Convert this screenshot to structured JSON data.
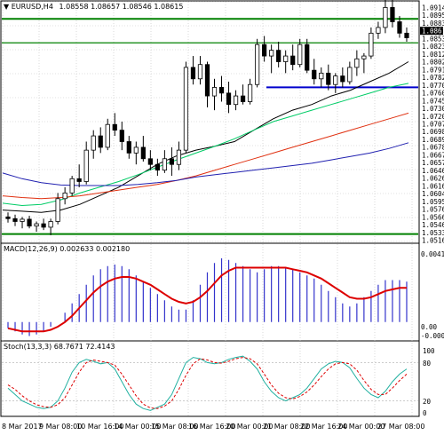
{
  "header": {
    "symbol": "EURUSD,H4",
    "ohlc": "1.08558 1.08657 1.08546 1.08615"
  },
  "price_axis": {
    "labels": [
      "1.09140",
      "1.08950",
      "1.08835",
      "1.08615",
      "1.08530",
      "1.08230",
      "1.08125",
      "1.08025",
      "1.07915",
      "1.07825",
      "1.07700",
      "1.07605",
      "1.07450",
      "1.07300",
      "1.07200",
      "1.07075",
      "1.06985",
      "1.06895",
      "1.06785",
      "1.06670",
      "1.06575",
      "1.06460",
      "1.06265",
      "1.06165",
      "1.06040",
      "1.05955",
      "1.05760",
      "1.05660",
      "1.05465",
      "1.05330",
      "1.05160"
    ],
    "current_price": "1.08615"
  },
  "macd": {
    "label": "MACD(12,26,9) 0.002633 0.002180",
    "axis_labels": [
      "0.004116",
      "0.00",
      "-0.000901"
    ]
  },
  "stoch": {
    "label": "Stoch(13,3,3) 68.7671 72.4143",
    "axis_labels": [
      "100",
      "80",
      "20",
      "0"
    ]
  },
  "time_axis": [
    "8 Mar 2017",
    "9 Mar 08:00",
    "10 Mar 16:00",
    "14 Mar 00:00",
    "15 Mar 08:00",
    "16 Mar 16:00",
    "20 Mar 00:00",
    "21 Mar 08:00",
    "22 Mar 16:00",
    "24 Mar 00:00",
    "27 Mar 08:00"
  ],
  "colors": {
    "candle": "#000000",
    "support_resistance": "#008000",
    "pivot_line": "#0000cc",
    "ma_fast": "#000000",
    "ma_mid": "#00cc66",
    "ma_slow": "#e03010",
    "ma_long": "#2020b0",
    "macd_hist": "#3333cc",
    "macd_signal": "#dd0000",
    "stoch_main": "#20b0a0",
    "stoch_signal": "#dd0000"
  },
  "chart_data": {
    "type": "candlestick",
    "symbol": "EURUSD",
    "timeframe": "H4",
    "horizontal_levels": [
      1.0895,
      1.0853,
      1.0775,
      1.0518
    ],
    "candles": [
      [
        1.0548,
        1.0556,
        1.0538,
        1.0545
      ],
      [
        1.0545,
        1.0552,
        1.0532,
        1.054
      ],
      [
        1.054,
        1.0548,
        1.0528,
        1.0544
      ],
      [
        1.0544,
        1.055,
        1.0528,
        1.0532
      ],
      [
        1.0532,
        1.054,
        1.0522,
        1.0536
      ],
      [
        1.0536,
        1.0545,
        1.0525,
        1.053
      ],
      [
        1.053,
        1.0545,
        1.0516,
        1.054
      ],
      [
        1.054,
        1.059,
        1.0535,
        1.058
      ],
      [
        1.058,
        1.06,
        1.057,
        1.059
      ],
      [
        1.059,
        1.062,
        1.0585,
        1.0615
      ],
      [
        1.0615,
        1.064,
        1.06,
        1.061
      ],
      [
        1.061,
        1.068,
        1.0605,
        1.0665
      ],
      [
        1.0665,
        1.07,
        1.065,
        1.069
      ],
      [
        1.069,
        1.0705,
        1.066,
        1.067
      ],
      [
        1.067,
        1.072,
        1.0665,
        1.071
      ],
      [
        1.071,
        1.073,
        1.069,
        1.07
      ],
      [
        1.07,
        1.0715,
        1.0665,
        1.068
      ],
      [
        1.068,
        1.069,
        1.065,
        1.066
      ],
      [
        1.066,
        1.068,
        1.064,
        1.067
      ],
      [
        1.067,
        1.069,
        1.0645,
        1.065
      ],
      [
        1.065,
        1.0665,
        1.063,
        1.064
      ],
      [
        1.064,
        1.065,
        1.062,
        1.063
      ],
      [
        1.063,
        1.0665,
        1.0625,
        1.065
      ],
      [
        1.065,
        1.067,
        1.062,
        1.064
      ],
      [
        1.064,
        1.068,
        1.063,
        1.0665
      ],
      [
        1.0665,
        1.082,
        1.066,
        1.081
      ],
      [
        1.081,
        1.083,
        1.078,
        1.079
      ],
      [
        1.079,
        1.083,
        1.078,
        1.0815
      ],
      [
        1.0815,
        1.082,
        1.074,
        1.076
      ],
      [
        1.076,
        1.079,
        1.0735,
        1.0775
      ],
      [
        1.0775,
        1.0795,
        1.075,
        1.0765
      ],
      [
        1.0765,
        1.0785,
        1.073,
        1.0745
      ],
      [
        1.0745,
        1.077,
        1.0735,
        1.076
      ],
      [
        1.076,
        1.078,
        1.0745,
        1.075
      ],
      [
        1.075,
        1.079,
        1.0745,
        1.078
      ],
      [
        1.078,
        1.086,
        1.0775,
        1.085
      ],
      [
        1.085,
        1.0865,
        1.082,
        1.083
      ],
      [
        1.083,
        1.085,
        1.08,
        1.084
      ],
      [
        1.084,
        1.0855,
        1.081,
        1.082
      ],
      [
        1.082,
        1.084,
        1.08,
        1.083
      ],
      [
        1.083,
        1.085,
        1.0805,
        1.0815
      ],
      [
        1.0815,
        1.086,
        1.081,
        1.085
      ],
      [
        1.085,
        1.086,
        1.08,
        1.0805
      ],
      [
        1.0805,
        1.0825,
        1.078,
        1.079
      ],
      [
        1.079,
        1.081,
        1.0775,
        1.08
      ],
      [
        1.08,
        1.0815,
        1.077,
        1.078
      ],
      [
        1.078,
        1.08,
        1.0765,
        1.0795
      ],
      [
        1.0795,
        1.081,
        1.0775,
        1.0785
      ],
      [
        1.0785,
        1.082,
        1.078,
        1.081
      ],
      [
        1.081,
        1.084,
        1.0795,
        1.0825
      ],
      [
        1.0825,
        1.0835,
        1.08,
        1.083
      ],
      [
        1.083,
        1.088,
        1.0825,
        1.087
      ],
      [
        1.087,
        1.089,
        1.086,
        1.088
      ],
      [
        1.088,
        1.093,
        1.087,
        1.0915
      ],
      [
        1.0915,
        1.095,
        1.088,
        1.089
      ],
      [
        1.089,
        1.09,
        1.0862,
        1.087
      ],
      [
        1.087,
        1.088,
        1.0855,
        1.0862
      ]
    ],
    "moving_averages": [
      {
        "color": "#000000",
        "values": [
          1.056,
          1.0558,
          1.0556,
          1.056,
          1.057,
          1.0585,
          1.06,
          1.062,
          1.064,
          1.0655,
          1.0665,
          1.0672,
          1.068,
          1.07,
          1.072,
          1.0735,
          1.0745,
          1.076,
          1.077,
          1.0785,
          1.08,
          1.082
        ]
      },
      {
        "color": "#00cc66",
        "values": [
          1.0572,
          1.0568,
          1.057,
          1.0578,
          1.059,
          1.06,
          1.061,
          1.0622,
          1.0635,
          1.0648,
          1.066,
          1.0672,
          1.0685,
          1.07,
          1.0715,
          1.0725,
          1.0735,
          1.0745,
          1.0755,
          1.0765,
          1.0775,
          1.0782
        ]
      },
      {
        "color": "#e03010",
        "values": [
          1.0585,
          1.0582,
          1.058,
          1.0582,
          1.0585,
          1.059,
          1.0595,
          1.06,
          1.0605,
          1.0612,
          1.062,
          1.063,
          1.064,
          1.065,
          1.066,
          1.067,
          1.068,
          1.069,
          1.07,
          1.071,
          1.072,
          1.073
        ]
      },
      {
        "color": "#2020b0",
        "values": [
          1.0625,
          1.0615,
          1.0608,
          1.0604,
          1.0603,
          1.0603,
          1.0603,
          1.0605,
          1.0608,
          1.0612,
          1.0618,
          1.0622,
          1.0626,
          1.063,
          1.0634,
          1.0638,
          1.0642,
          1.0648,
          1.0654,
          1.066,
          1.0668,
          1.0678
        ]
      }
    ],
    "macd_histogram": [
      -0.0004,
      -0.0006,
      -0.0008,
      -0.0009,
      -0.0008,
      -0.0006,
      -0.0003,
      0.0,
      0.0006,
      0.0012,
      0.0018,
      0.0024,
      0.003,
      0.0034,
      0.0036,
      0.0037,
      0.0036,
      0.0034,
      0.003,
      0.0026,
      0.0022,
      0.0018,
      0.0014,
      0.001,
      0.0008,
      0.0008,
      0.0014,
      0.0024,
      0.0032,
      0.0038,
      0.0041,
      0.004,
      0.0038,
      0.0036,
      0.0034,
      0.0032,
      0.0034,
      0.0036,
      0.0036,
      0.0035,
      0.0034,
      0.0032,
      0.003,
      0.0028,
      0.0024,
      0.002,
      0.0016,
      0.0012,
      0.001,
      0.0012,
      0.0016,
      0.002,
      0.0024,
      0.0027,
      0.0027,
      0.0027,
      0.0026
    ],
    "macd_signal": [
      -0.0004,
      -0.0005,
      -0.0006,
      -0.0006,
      -0.0006,
      -0.0006,
      -0.0005,
      -0.0003,
      0.0,
      0.0004,
      0.0009,
      0.0014,
      0.0019,
      0.0023,
      0.0026,
      0.0028,
      0.0029,
      0.0029,
      0.0028,
      0.0026,
      0.0024,
      0.0021,
      0.0018,
      0.0015,
      0.0013,
      0.0012,
      0.0013,
      0.0016,
      0.002,
      0.0025,
      0.003,
      0.0033,
      0.0035,
      0.0035,
      0.0035,
      0.0035,
      0.0035,
      0.0035,
      0.0035,
      0.0035,
      0.0034,
      0.0033,
      0.0032,
      0.003,
      0.0028,
      0.0025,
      0.0022,
      0.0019,
      0.0016,
      0.0015,
      0.0015,
      0.0016,
      0.0018,
      0.002,
      0.0021,
      0.0022,
      0.0022
    ],
    "stoch_main": [
      40,
      30,
      20,
      15,
      10,
      8,
      10,
      20,
      40,
      65,
      80,
      85,
      82,
      78,
      80,
      70,
      50,
      30,
      15,
      8,
      5,
      10,
      15,
      30,
      55,
      80,
      88,
      86,
      80,
      78,
      80,
      85,
      88,
      90,
      82,
      70,
      50,
      35,
      25,
      20,
      25,
      30,
      40,
      55,
      70,
      78,
      82,
      80,
      72,
      55,
      40,
      30,
      25,
      35,
      50,
      62,
      70
    ],
    "stoch_signal": [
      45,
      38,
      28,
      20,
      14,
      11,
      10,
      14,
      25,
      45,
      65,
      80,
      84,
      82,
      80,
      76,
      62,
      45,
      28,
      15,
      9,
      8,
      12,
      20,
      38,
      60,
      78,
      86,
      84,
      80,
      79,
      82,
      86,
      88,
      86,
      78,
      62,
      45,
      32,
      25,
      23,
      27,
      34,
      45,
      58,
      70,
      78,
      80,
      78,
      68,
      52,
      38,
      30,
      30,
      40,
      52,
      62
    ]
  }
}
